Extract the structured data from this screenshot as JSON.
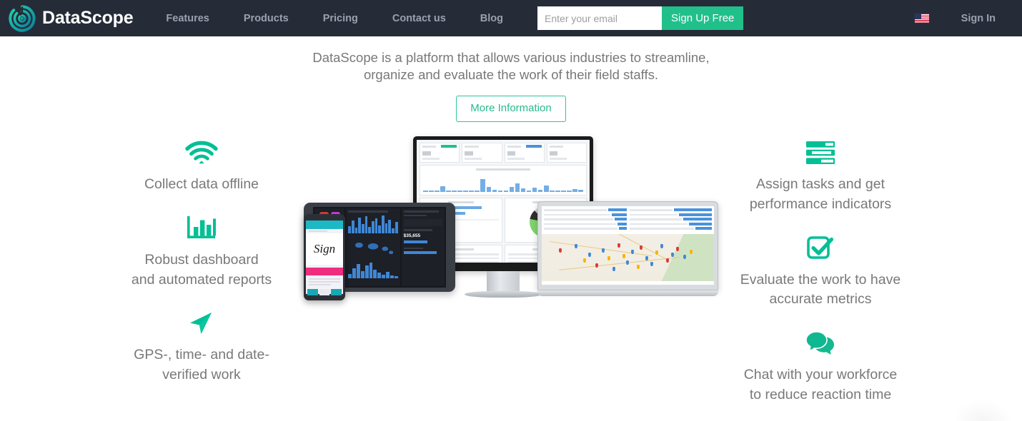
{
  "brand": {
    "name": "DataScope",
    "logo_icon": "datascope-target-logo",
    "logo_color_start": "#1fc4a6",
    "logo_color_end": "#0f8fa8"
  },
  "nav": {
    "links": [
      {
        "label": "Features"
      },
      {
        "label": "Products"
      },
      {
        "label": "Pricing"
      },
      {
        "label": "Contact us"
      },
      {
        "label": "Blog"
      }
    ],
    "email_placeholder": "Enter your email",
    "email_value": "",
    "signup_label": "Sign Up Free",
    "signup_color": "#21c08b",
    "language_flag": "us-flag-icon",
    "signin_label": "Sign In",
    "background_color": "#262b38"
  },
  "hero": {
    "subtitle": "DataScope is a platform that allows various industries to streamline, organize and evaluate the work of their field staffs.",
    "cta_label": "More Information",
    "cta_color": "#2ab98f"
  },
  "features": {
    "accent_color": "#02bf96",
    "left": [
      {
        "icon": "wifi-icon",
        "label": "Collect data offline"
      },
      {
        "icon": "bar-chart-icon",
        "label": "Robust dashboard\nand automated reports"
      },
      {
        "icon": "navigation-arrow-icon",
        "label": "GPS-, time- and date-\nverified work"
      }
    ],
    "right": [
      {
        "icon": "task-list-icon",
        "label": "Assign tasks and get\nperformance indicators"
      },
      {
        "icon": "checkbox-check-icon",
        "label": "Evaluate the work to have\naccurate metrics"
      },
      {
        "icon": "chat-bubbles-icon",
        "label": "Chat with your workforce\nto reduce reaction time"
      }
    ]
  },
  "devices": {
    "alt": "DataScope dashboards shown on phone, tablet, desktop monitor and laptop",
    "items": [
      {
        "name": "smartphone",
        "screen": "signature capture form"
      },
      {
        "name": "tablet",
        "screen": "dark analytics dashboard"
      },
      {
        "name": "desktop-monitor",
        "screen": "forms per day dashboard with bar and pie charts"
      },
      {
        "name": "laptop",
        "screen": "map with colored location pins"
      }
    ],
    "monitor_kpis": [
      "Forms",
      "Users",
      "Assigned Tasks",
      "Completed Tasks"
    ],
    "monitor_chart_title": "N° Forms per day",
    "monitor_panels": [
      "Answers per user level",
      "Answers by question",
      "Question 1",
      "Question 2"
    ],
    "tablet_metric": "$35,655",
    "tablet_metric_delta": "+ 21.4%"
  },
  "chat_widget": {
    "name": "chat-widget-shadow"
  }
}
